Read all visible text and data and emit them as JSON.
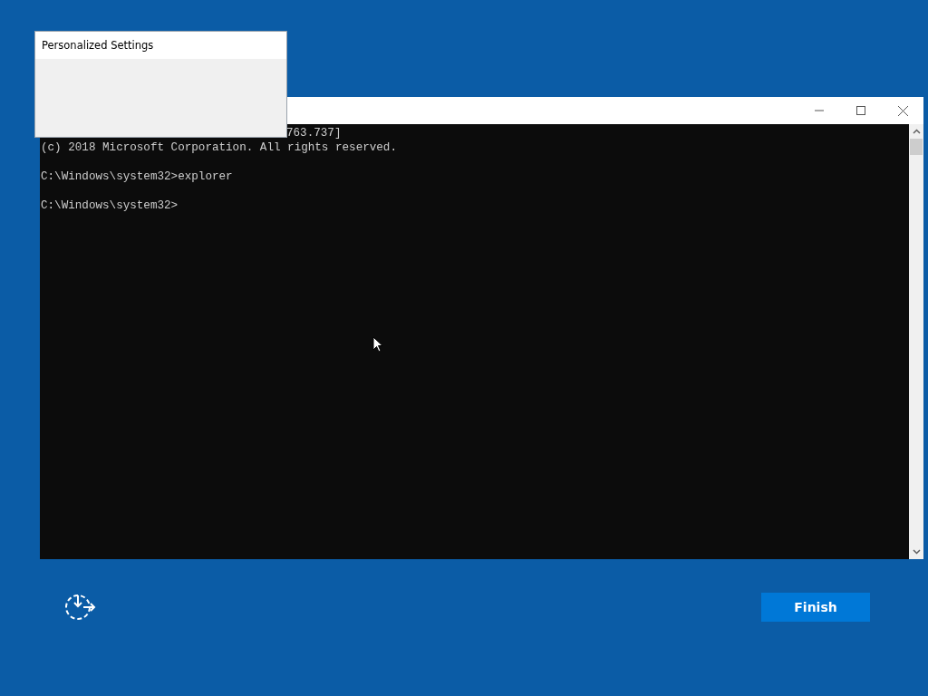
{
  "console_window": {
    "lines": [
      {
        "text": "763.737]",
        "kind": "partial"
      },
      {
        "text": "(c) 2018 Microsoft Corporation. All rights reserved.",
        "kind": "full"
      },
      {
        "kind": "blank"
      },
      {
        "text": "C:\\Windows\\system32>explorer",
        "kind": "full"
      },
      {
        "kind": "blank"
      },
      {
        "text": "C:\\Windows\\system32>",
        "kind": "full"
      }
    ]
  },
  "settings_window": {
    "title": "Personalized Settings"
  },
  "footer": {
    "button": "Finish"
  }
}
